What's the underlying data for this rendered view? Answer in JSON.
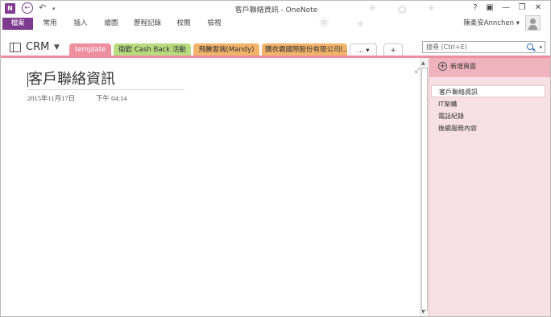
{
  "window": {
    "title": "客戶聯絡資訊 - OneNote",
    "app_icon_label": "N",
    "help_button": "?",
    "ribbon_display_button": "▣",
    "minimize_button": "—",
    "restore_button": "❐",
    "close_button": "✕"
  },
  "quick_access": {
    "back_icon": "←",
    "undo_icon": "↶",
    "customize_icon": "▾"
  },
  "ribbon": {
    "tabs": [
      {
        "label": "檔案"
      },
      {
        "label": "常用"
      },
      {
        "label": "插入"
      },
      {
        "label": "繪圖"
      },
      {
        "label": "歷程記錄"
      },
      {
        "label": "校閱"
      },
      {
        "label": "檢視"
      }
    ],
    "user_name": "陳柔安Annchen",
    "user_dropdown": "▾"
  },
  "notebook": {
    "name": "CRM",
    "dropdown": "▼"
  },
  "sections": [
    {
      "label": "template",
      "color": "#ee8fa0"
    },
    {
      "label": "衛歡 Cash Back 活動",
      "color": "#b9db7f"
    },
    {
      "label": "飛騰雲端(Mandy)",
      "color": "#f2b36b"
    },
    {
      "label": "購衣霸國際股份有限公司(...",
      "color": "#f2b36b"
    },
    {
      "label": "... ▾",
      "color": "#ffffff"
    },
    {
      "label": "+",
      "color": "#ffffff"
    }
  ],
  "search": {
    "placeholder": "搜尋 (Ctrl+E)",
    "dropdown": "▾"
  },
  "page": {
    "title": "客戶聯絡資訊",
    "date": "2015年11月17日",
    "time": "下午 04:14",
    "expand_icon": "⤢"
  },
  "scrollbar": {
    "up_arrow": "▲",
    "down_arrow": "▼"
  },
  "page_list": {
    "add_icon": "+",
    "add_page_label": "新增頁面",
    "pages": [
      {
        "label": "客戶聯絡資訊",
        "selected": true
      },
      {
        "label": "IT架構",
        "selected": false
      },
      {
        "label": "電話紀錄",
        "selected": false
      },
      {
        "label": "後續服務內容",
        "selected": false
      }
    ]
  },
  "colors": {
    "accent": "#7e3a8e",
    "section_active": "#ee8fa0",
    "page_list_bg": "#f7e1e4",
    "page_list_header": "#efb3bd"
  }
}
